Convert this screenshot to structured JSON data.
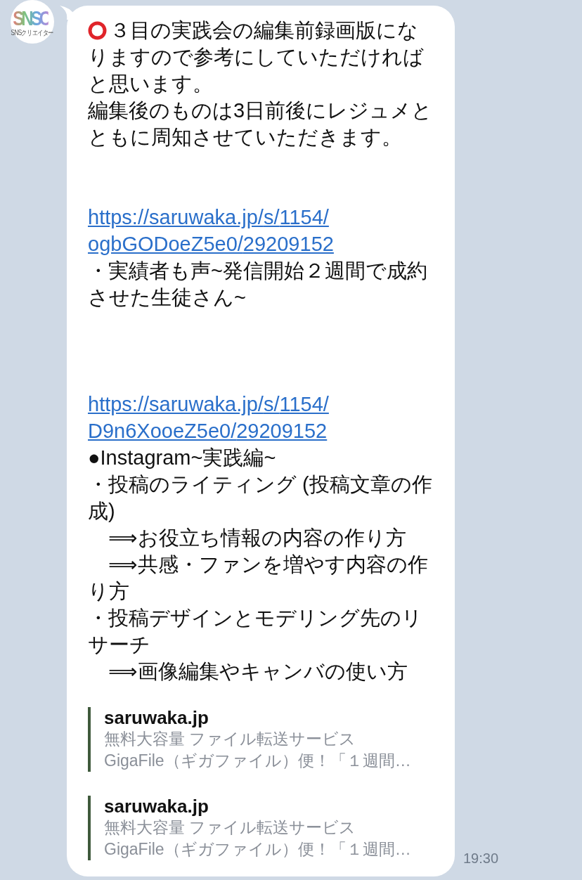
{
  "avatar": {
    "logo": "SNSC",
    "caption": "SNSクリエイター"
  },
  "message": {
    "blocks": [
      {
        "kind": "text",
        "ring_icon": true,
        "text": "３目の実践会の編集前録画版になりますので参考にしていただければと思います。"
      },
      {
        "kind": "text",
        "text": "編集後のものは3日前後にレジュメとともに周知させていただきます。"
      },
      {
        "kind": "blank"
      },
      {
        "kind": "blank"
      },
      {
        "kind": "link",
        "text": "https://saruwaka.jp/s/1154/ogbGODoeZ5e0/29209152"
      },
      {
        "kind": "text",
        "text": "・実績者も声~発信開始２週間で成約させた生徒さん~"
      },
      {
        "kind": "blank"
      },
      {
        "kind": "blank"
      },
      {
        "kind": "blank"
      },
      {
        "kind": "link",
        "text": "https://saruwaka.jp/s/1154/D9n6XooeZ5e0/29209152"
      },
      {
        "kind": "text",
        "text": "●Instagram~実践編~"
      },
      {
        "kind": "text",
        "text": "・投稿のライティング (投稿文章の作成)"
      },
      {
        "kind": "text",
        "text": "　⟹お役立ち情報の内容の作り方"
      },
      {
        "kind": "text",
        "text": "　⟹共感・ファンを増やす内容の作り方"
      },
      {
        "kind": "text",
        "text": "・投稿デザインとモデリング先のリサーチ"
      },
      {
        "kind": "text",
        "text": "　⟹画像編集やキャンバの使い方"
      }
    ],
    "previews": [
      {
        "site": "saruwaka.jp",
        "lines": [
          "無料大容量 ファイル転送サービス",
          "GigaFile（ギガファイル）便！「１週間…"
        ]
      },
      {
        "site": "saruwaka.jp",
        "lines": [
          "無料大容量 ファイル転送サービス",
          "GigaFile（ギガファイル）便！「１週間…"
        ]
      }
    ],
    "time": "19:30"
  }
}
